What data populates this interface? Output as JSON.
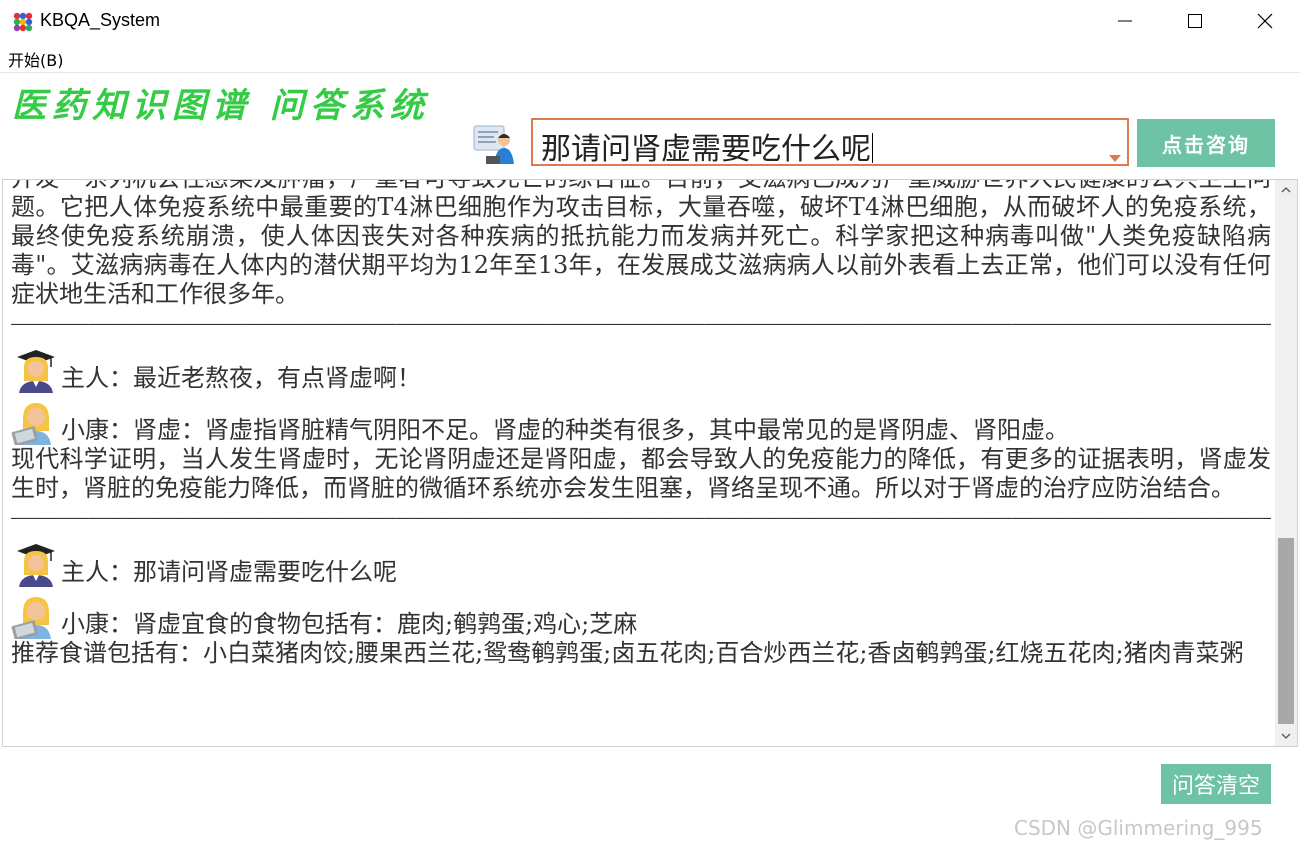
{
  "window": {
    "title": "KBQA_System",
    "icons": {
      "app": "app-dots-icon",
      "minimize": "minimize-icon",
      "maximize": "maximize-icon",
      "close": "close-icon"
    }
  },
  "menu": {
    "items": [
      {
        "label": "开始(B)"
      }
    ]
  },
  "header": {
    "title": "医药知识图谱  问答系统",
    "title_color": "#33cc44",
    "avatar_icon": "doctor-avatar-icon"
  },
  "query": {
    "value": "那请问肾虚需要吃什么呢",
    "submit_label": "点击咨询",
    "accent_color": "#6dc3a4",
    "border_color": "#e0794d"
  },
  "chat": {
    "prior_text": "并发一系列机会性感染及肿瘤，严重者可导致死亡的综合征。目前，艾滋病已成为严重威胁世界人民健康的公共卫生问题。它把人体免疫系统中最重要的T4淋巴细胞作为攻击目标，大量吞噬，破坏T4淋巴细胞，从而破坏人的免疫系统，最终使免疫系统崩溃，使人体因丧失对各种疾病的抵抗能力而发病并死亡。科学家把这种病毒叫做\"人类免疫缺陷病毒\"。艾滋病病毒在人体内的潜伏期平均为12年至13年，在发展成艾滋病病人以前外表看上去正常，他们可以没有任何症状地生活和工作很多年。",
    "separator": "———————————————————————————————————————————————————————————————————————————————————————————————————————————————————————————————————————————————————————————",
    "exchanges": [
      {
        "user": "主人：最近老熬夜，有点肾虚啊！",
        "bot": "小康：肾虚：肾虚指肾脏精气阴阳不足。肾虚的种类有很多，其中最常见的是肾阴虚、肾阳虚。",
        "bot_continuation": "现代科学证明，当人发生肾虚时，无论肾阴虚还是肾阳虚，都会导致人的免疫能力的降低，有更多的证据表明，肾虚发生时，肾脏的免疫能力降低，而肾脏的微循环系统亦会发生阻塞，肾络呈现不通。所以对于肾虚的治疗应防治结合。"
      },
      {
        "user": "主人：那请问肾虚需要吃什么呢",
        "bot": "小康：肾虚宜食的食物包括有：鹿肉;鹌鹑蛋;鸡心;芝麻",
        "bot_continuation": "推荐食谱包括有：小白菜猪肉饺;腰果西兰花;鸳鸯鹌鹑蛋;卤五花肉;百合炒西兰花;香卤鹌鹑蛋;红烧五花肉;猪肉青菜粥"
      }
    ],
    "user_avatar_icon": "graduate-avatar-icon",
    "bot_avatar_icon": "laptop-user-avatar-icon"
  },
  "footer": {
    "clear_label": "问答清空",
    "watermark": "CSDN @Glimmering_995"
  }
}
